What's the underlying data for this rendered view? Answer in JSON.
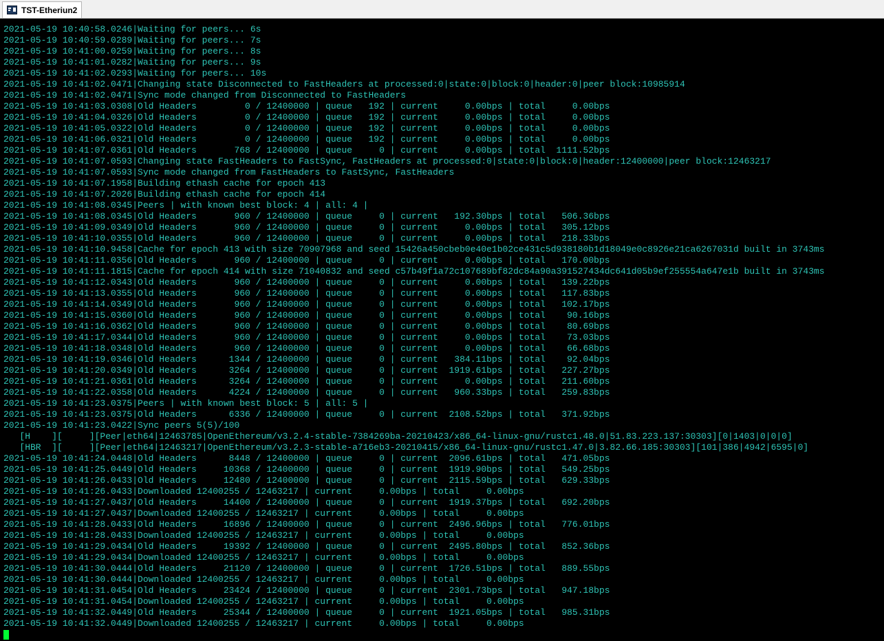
{
  "window": {
    "tab_title": "TST-Etheriun2",
    "tab_icon": "terminal-icon"
  },
  "colors": {
    "terminal_bg": "#000000",
    "terminal_fg": "#2ec4b6",
    "cursor": "#00ff33"
  },
  "terminal": {
    "lines": [
      "2021-05-19 10:40:58.0246|Waiting for peers... 6s",
      "2021-05-19 10:40:59.0289|Waiting for peers... 7s",
      "2021-05-19 10:41:00.0259|Waiting for peers... 8s",
      "2021-05-19 10:41:01.0282|Waiting for peers... 9s",
      "2021-05-19 10:41:02.0293|Waiting for peers... 10s",
      "2021-05-19 10:41:02.0471|Changing state Disconnected to FastHeaders at processed:0|state:0|block:0|header:0|peer block:10985914",
      "2021-05-19 10:41:02.0471|Sync mode changed from Disconnected to FastHeaders",
      "2021-05-19 10:41:03.0308|Old Headers         0 / 12400000 | queue   192 | current     0.00bps | total     0.00bps",
      "2021-05-19 10:41:04.0326|Old Headers         0 / 12400000 | queue   192 | current     0.00bps | total     0.00bps",
      "2021-05-19 10:41:05.0322|Old Headers         0 / 12400000 | queue   192 | current     0.00bps | total     0.00bps",
      "2021-05-19 10:41:06.0321|Old Headers         0 / 12400000 | queue   192 | current     0.00bps | total     0.00bps",
      "2021-05-19 10:41:07.0361|Old Headers       768 / 12400000 | queue     0 | current     0.00bps | total  1111.52bps",
      "2021-05-19 10:41:07.0593|Changing state FastHeaders to FastSync, FastHeaders at processed:0|state:0|block:0|header:12400000|peer block:12463217",
      "2021-05-19 10:41:07.0593|Sync mode changed from FastHeaders to FastSync, FastHeaders",
      "2021-05-19 10:41:07.1958|Building ethash cache for epoch 413",
      "2021-05-19 10:41:07.2026|Building ethash cache for epoch 414",
      "2021-05-19 10:41:08.0345|Peers | with known best block: 4 | all: 4 |",
      "2021-05-19 10:41:08.0345|Old Headers       960 / 12400000 | queue     0 | current   192.30bps | total   506.36bps",
      "2021-05-19 10:41:09.0349|Old Headers       960 / 12400000 | queue     0 | current     0.00bps | total   305.12bps",
      "2021-05-19 10:41:10.0355|Old Headers       960 / 12400000 | queue     0 | current     0.00bps | total   218.33bps",
      "2021-05-19 10:41:10.9458|Cache for epoch 413 with size 70907968 and seed 15426a450cbeb0e40e1b02ce431c5d938180b1d18049e0c8926e21ca6267031d built in 3743ms",
      "2021-05-19 10:41:11.0356|Old Headers       960 / 12400000 | queue     0 | current     0.00bps | total   170.00bps",
      "2021-05-19 10:41:11.1815|Cache for epoch 414 with size 71040832 and seed c57b49f1a72c107689bf82dc84a90a391527434dc641d05b9ef255554a647e1b built in 3743ms",
      "2021-05-19 10:41:12.0343|Old Headers       960 / 12400000 | queue     0 | current     0.00bps | total   139.22bps",
      "2021-05-19 10:41:13.0355|Old Headers       960 / 12400000 | queue     0 | current     0.00bps | total   117.83bps",
      "2021-05-19 10:41:14.0349|Old Headers       960 / 12400000 | queue     0 | current     0.00bps | total   102.17bps",
      "2021-05-19 10:41:15.0360|Old Headers       960 / 12400000 | queue     0 | current     0.00bps | total    90.16bps",
      "2021-05-19 10:41:16.0362|Old Headers       960 / 12400000 | queue     0 | current     0.00bps | total    80.69bps",
      "2021-05-19 10:41:17.0344|Old Headers       960 / 12400000 | queue     0 | current     0.00bps | total    73.03bps",
      "2021-05-19 10:41:18.0348|Old Headers       960 / 12400000 | queue     0 | current     0.00bps | total    66.68bps",
      "2021-05-19 10:41:19.0346|Old Headers      1344 / 12400000 | queue     0 | current   384.11bps | total    92.04bps",
      "2021-05-19 10:41:20.0349|Old Headers      3264 / 12400000 | queue     0 | current  1919.61bps | total   227.27bps",
      "2021-05-19 10:41:21.0361|Old Headers      3264 / 12400000 | queue     0 | current     0.00bps | total   211.60bps",
      "2021-05-19 10:41:22.0358|Old Headers      4224 / 12400000 | queue     0 | current   960.33bps | total   259.83bps",
      "2021-05-19 10:41:23.0375|Peers | with known best block: 5 | all: 5 |",
      "2021-05-19 10:41:23.0375|Old Headers      6336 / 12400000 | queue     0 | current  2108.52bps | total   371.92bps",
      "2021-05-19 10:41:23.0422|Sync peers 5(5)/100",
      "   [H    ][     ][Peer|eth64|12463785|OpenEthereum/v3.2.4-stable-7384269ba-20210423/x86_64-linux-gnu/rustc1.48.0|51.83.223.137:30303][0|1403|0|0|0]",
      "   [HBR  ][     ][Peer|eth64|12463217|OpenEthereum/v3.2.3-stable-a716eb3-20210415/x86_64-linux-gnu/rustc1.47.0|3.82.66.185:30303][101|386|4942|6595|0]",
      "2021-05-19 10:41:24.0448|Old Headers      8448 / 12400000 | queue     0 | current  2096.61bps | total   471.05bps",
      "2021-05-19 10:41:25.0449|Old Headers     10368 / 12400000 | queue     0 | current  1919.90bps | total   549.25bps",
      "2021-05-19 10:41:26.0433|Old Headers     12480 / 12400000 | queue     0 | current  2115.59bps | total   629.33bps",
      "2021-05-19 10:41:26.0433|Downloaded 12400255 / 12463217 | current     0.00bps | total     0.00bps",
      "2021-05-19 10:41:27.0437|Old Headers     14400 / 12400000 | queue     0 | current  1919.37bps | total   692.20bps",
      "2021-05-19 10:41:27.0437|Downloaded 12400255 / 12463217 | current     0.00bps | total     0.00bps",
      "2021-05-19 10:41:28.0433|Old Headers     16896 / 12400000 | queue     0 | current  2496.96bps | total   776.01bps",
      "2021-05-19 10:41:28.0433|Downloaded 12400255 / 12463217 | current     0.00bps | total     0.00bps",
      "2021-05-19 10:41:29.0434|Old Headers     19392 / 12400000 | queue     0 | current  2495.80bps | total   852.36bps",
      "2021-05-19 10:41:29.0434|Downloaded 12400255 / 12463217 | current     0.00bps | total     0.00bps",
      "2021-05-19 10:41:30.0444|Old Headers     21120 / 12400000 | queue     0 | current  1726.51bps | total   889.55bps",
      "2021-05-19 10:41:30.0444|Downloaded 12400255 / 12463217 | current     0.00bps | total     0.00bps",
      "2021-05-19 10:41:31.0454|Old Headers     23424 / 12400000 | queue     0 | current  2301.73bps | total   947.18bps",
      "2021-05-19 10:41:31.0454|Downloaded 12400255 / 12463217 | current     0.00bps | total     0.00bps",
      "2021-05-19 10:41:32.0449|Old Headers     25344 / 12400000 | queue     0 | current  1921.05bps | total   985.31bps",
      "2021-05-19 10:41:32.0449|Downloaded 12400255 / 12463217 | current     0.00bps | total     0.00bps"
    ]
  }
}
